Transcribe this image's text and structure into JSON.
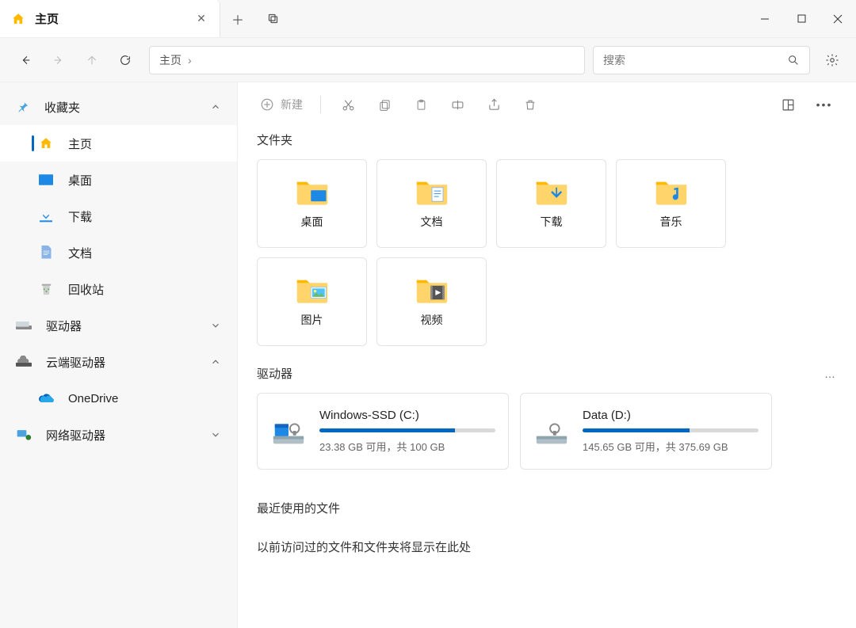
{
  "window": {
    "title": "主页"
  },
  "tabbar": {
    "title": "主页"
  },
  "nav": {
    "breadcrumb": "主页",
    "search_placeholder": "搜索"
  },
  "toolbar": {
    "new_label": "新建"
  },
  "sidebar": {
    "favorites": {
      "label": "收藏夹",
      "items": [
        {
          "label": "主页"
        },
        {
          "label": "桌面"
        },
        {
          "label": "下载"
        },
        {
          "label": "文档"
        },
        {
          "label": "回收站"
        }
      ]
    },
    "drives": {
      "label": "驱动器"
    },
    "cloud": {
      "label": "云端驱动器",
      "items": [
        {
          "label": "OneDrive"
        }
      ]
    },
    "network": {
      "label": "网络驱动器"
    }
  },
  "sections": {
    "folders_title": "文件夹",
    "folders": [
      {
        "label": "桌面"
      },
      {
        "label": "文档"
      },
      {
        "label": "下载"
      },
      {
        "label": "音乐"
      },
      {
        "label": "图片"
      },
      {
        "label": "视频"
      }
    ],
    "drives_title": "驱动器",
    "drives": [
      {
        "name": "Windows-SSD (C:)",
        "usage_text": "23.38 GB 可用，共 100 GB",
        "fill_pct": 77
      },
      {
        "name": "Data (D:)",
        "usage_text": "145.65 GB 可用，共 375.69 GB",
        "fill_pct": 61
      }
    ],
    "recent_title": "最近使用的文件",
    "recent_empty": "以前访问过的文件和文件夹将显示在此处"
  }
}
